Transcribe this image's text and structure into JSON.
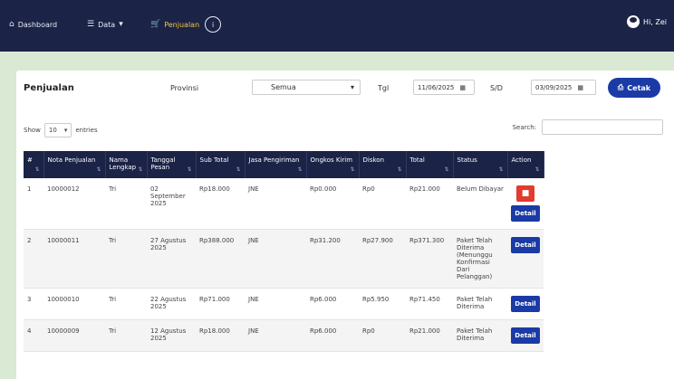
{
  "nav": {
    "dashboard_label": "Dashboard",
    "data_label": "Data",
    "penjualan_label": "Penjualan",
    "penjualan_badge": "i",
    "user_label": "Hi, Zei"
  },
  "page": {
    "title": "Penjualan",
    "provinsi_label": "Provinsi",
    "provinsi_value": "Semua",
    "tgl_label": "Tgl",
    "date_from": "11/06/2025",
    "sd_label": "S/D",
    "date_to": "03/09/2025",
    "cetak_label": "Cetak",
    "show_label": "Show",
    "entries_value": "10",
    "entries_label": "entries",
    "search_label": "Search:"
  },
  "table": {
    "headers": [
      "#",
      "Nota Penjualan",
      "Nama Lengkap",
      "Tanggal Pesan",
      "Sub Total",
      "Jasa Pengiriman",
      "Ongkos Kirim",
      "Diskon",
      "Total",
      "Status",
      "Action"
    ],
    "rows": [
      [
        "1",
        "10000012",
        "Tri",
        "02 September 2025",
        "Rp18.000",
        "JNE",
        "Rp0.000",
        "Rp0",
        "Rp21.000",
        "Belum Dibayar",
        "Detail"
      ],
      [
        "2",
        "10000011",
        "Tri",
        "27 Agustus 2025",
        "Rp388.000",
        "JNE",
        "Rp31.200",
        "Rp27.900",
        "Rp371.300",
        "Paket Telah Diterima (Menunggu Konfirmasi Dari Pelanggan)",
        "Detail"
      ],
      [
        "3",
        "10000010",
        "Tri",
        "22 Agustus 2025",
        "Rp71.000",
        "JNE",
        "Rp6.000",
        "Rp5.950",
        "Rp71.450",
        "Paket Telah Diterima",
        "Detail"
      ],
      [
        "4",
        "10000009",
        "Tri",
        "12 Agustus 2025",
        "Rp18.000",
        "JNE",
        "Rp6.000",
        "Rp0",
        "Rp21.000",
        "Paket Telah Diterima",
        "Detail"
      ]
    ]
  },
  "colors": {
    "navbar": "#1b2346",
    "accent": "#1a3aa6",
    "danger": "#e23b2f",
    "page_bg": "#d9e9d3"
  }
}
